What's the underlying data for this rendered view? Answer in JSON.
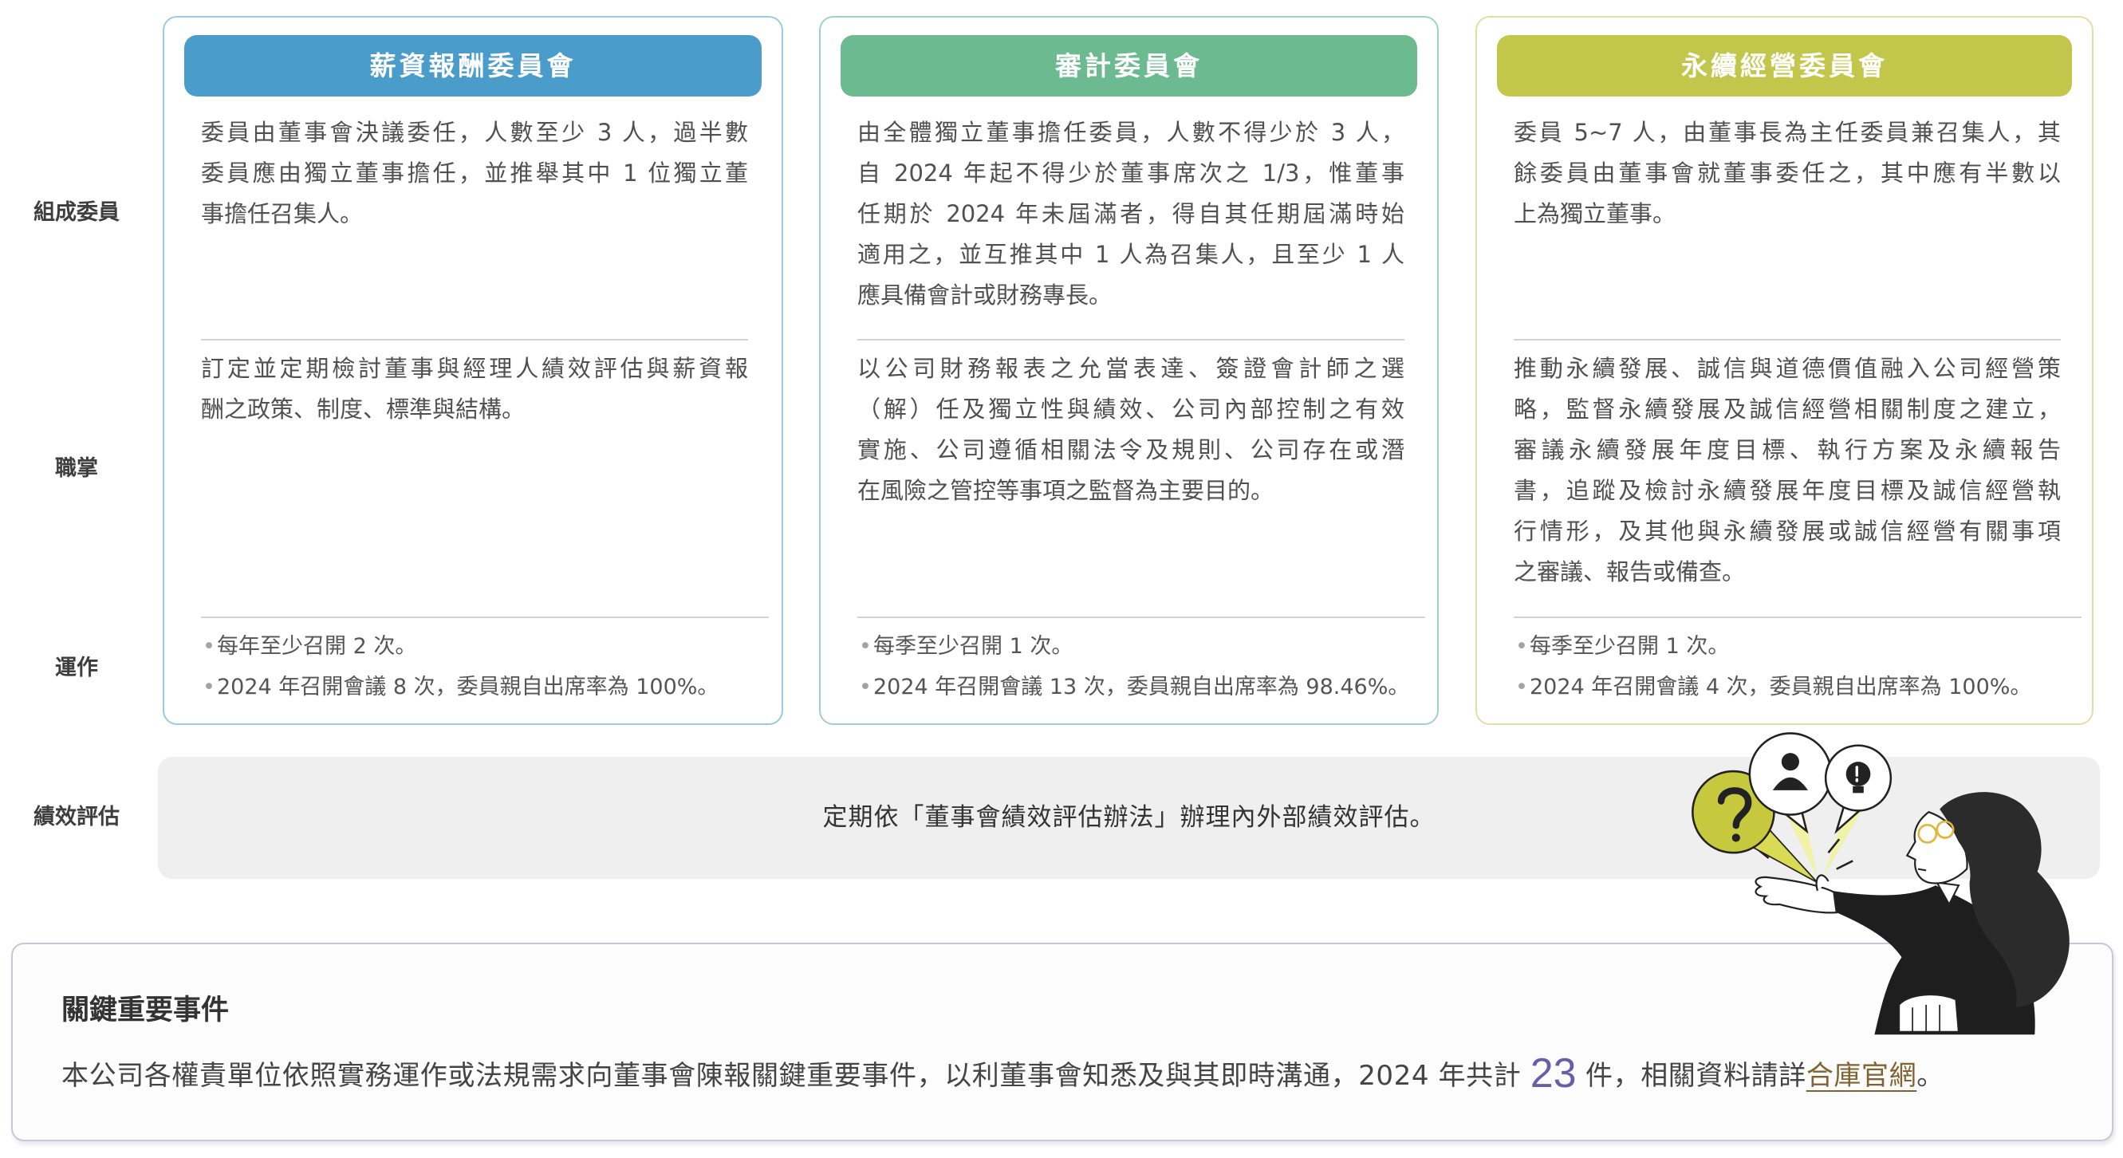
{
  "row_labels": {
    "composition": "組成委員",
    "duties": "職掌",
    "operations": "運作",
    "evaluation": "績效評估"
  },
  "committees": [
    {
      "title": "薪資報酬委員會",
      "color": "#4a9ccb",
      "border_color": "#9cc9e3",
      "composition_lines": [
        "委員由董事會決議委任，人數至少 3 人，過半數",
        "委員應由獨立董事擔任，並推舉其中 1 位獨立董",
        "事擔任召集人。"
      ],
      "duties_lines": [
        "訂定並定期檢討董事與經理人績效評估與薪資報",
        "酬之政策、制度、標準與結構。"
      ],
      "operations": [
        "每年至少召開 2 次。",
        "2024 年召開會議 8 次，委員親自出席率為 100%。"
      ]
    },
    {
      "title": "審計委員會",
      "color": "#6cba8f",
      "border_color": "#a0d3bf",
      "composition_lines": [
        "由全體獨立董事擔任委員，人數不得少於 3 人，",
        "自 2024 年起不得少於董事席次之 1/3，惟董事",
        "任期於 2024 年未屆滿者，得自其任期屆滿時始",
        "適用之，並互推其中 1 人為召集人，且至少 1 人",
        "應具備會計或財務專長。"
      ],
      "duties_lines": [
        "以公司財務報表之允當表達、簽證會計師之選",
        "（解）任及獨立性與績效、公司內部控制之有效",
        "實施、公司遵循相關法令及規則、公司存在或潛",
        "在風險之管控等事項之監督為主要目的。"
      ],
      "operations": [
        "每季至少召開 1 次。",
        "2024 年召開會議 13 次，委員親自出席率為 98.46%。"
      ]
    },
    {
      "title": "永續經營委員會",
      "color": "#c2c74c",
      "border_color": "#dde2a4",
      "composition_lines": [
        "委員 5~7 人，由董事長為主任委員兼召集人，其",
        "餘委員由董事會就董事委任之，其中應有半數以",
        "上為獨立董事。"
      ],
      "duties_lines": [
        "推動永續發展、誠信與道德價值融入公司經營策",
        "略，監督永續發展及誠信經營相關制度之建立，",
        "審議永續發展年度目標、執行方案及永續報告",
        "書，追蹤及檢討永續發展年度目標及誠信經營執",
        "行情形，及其他與永續發展或誠信經營有關事項",
        "之審議、報告或備查。"
      ],
      "operations": [
        "每季至少召開 1 次。",
        "2024 年召開會議 4 次，委員親自出席率為 100%。"
      ]
    }
  ],
  "performance": {
    "text": "定期依「董事會績效評估辦法」辦理內外部績效評估。"
  },
  "key_events": {
    "title": "關鍵重要事件",
    "text_before": "本公司各權責單位依照實務運作或法規需求向董事會陳報關鍵重要事件，以利董事會知悉及與其即時溝通，2024 年共計 ",
    "count": "23",
    "text_mid": " 件，相關資料請詳",
    "link": "合庫官網",
    "text_after": "。"
  },
  "colors": {
    "count_accent": "#6a5ca8",
    "link": "#7f6431",
    "evaluation_box": "#efefef",
    "events_border": "#cbc5d9"
  },
  "illustration": {
    "icons": [
      "question-mark-icon",
      "person-icon",
      "lightbulb-icon"
    ]
  }
}
